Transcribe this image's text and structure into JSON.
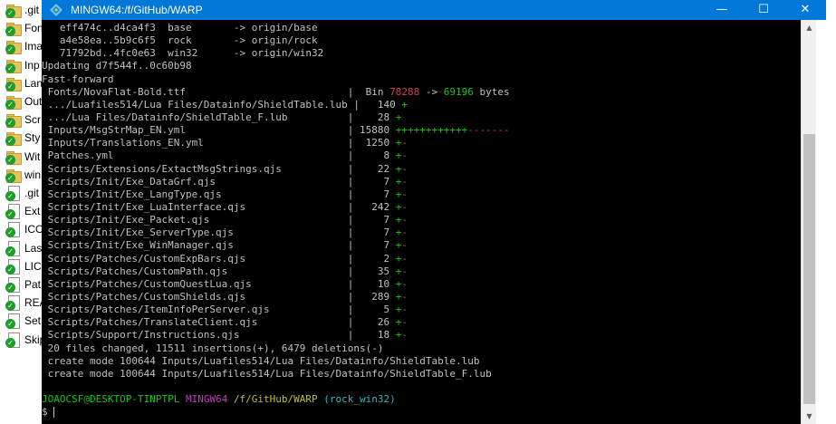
{
  "explorer": {
    "items": [
      {
        "label": ".git",
        "kind": "folder"
      },
      {
        "label": "Fon",
        "kind": "folder"
      },
      {
        "label": "Ima",
        "kind": "folder"
      },
      {
        "label": "Inp",
        "kind": "folder"
      },
      {
        "label": "Lan",
        "kind": "folder"
      },
      {
        "label": "Out",
        "kind": "folder"
      },
      {
        "label": "Scr",
        "kind": "folder"
      },
      {
        "label": "Sty",
        "kind": "folder"
      },
      {
        "label": "Wit",
        "kind": "folder"
      },
      {
        "label": "win",
        "kind": "folder"
      },
      {
        "label": ".git",
        "kind": "file"
      },
      {
        "label": "Ext",
        "kind": "file"
      },
      {
        "label": "ICO",
        "kind": "file"
      },
      {
        "label": "Las",
        "kind": "file"
      },
      {
        "label": "LIC",
        "kind": "file"
      },
      {
        "label": "Pat",
        "kind": "file"
      },
      {
        "label": "REA",
        "kind": "file"
      },
      {
        "label": "Set",
        "kind": "file"
      },
      {
        "label": "Skip",
        "kind": "file"
      }
    ]
  },
  "window": {
    "title": "MINGW64:/f/GitHub/WARP",
    "minimize": "—",
    "maximize": "☐",
    "close": "✕"
  },
  "terminal": {
    "lines": [
      [
        {
          "t": "   eff474c..d4ca4f3  base       -> origin/base",
          "c": "w"
        }
      ],
      [
        {
          "t": "   a4e58ea..5b9c6f5  rock       -> origin/rock",
          "c": "w"
        }
      ],
      [
        {
          "t": "   71792bd..4fc0e63  win32      -> origin/win32",
          "c": "w"
        }
      ],
      [
        {
          "t": "Updating d7f544f..0c60b98",
          "c": "w"
        }
      ],
      [
        {
          "t": "Fast-forward",
          "c": "w"
        }
      ],
      [
        {
          "t": " Fonts/NovaFlat-Bold.ttf                           |  Bin ",
          "c": "w"
        },
        {
          "t": "78288",
          "c": "r"
        },
        {
          "t": " -> ",
          "c": "w"
        },
        {
          "t": "69196",
          "c": "g"
        },
        {
          "t": " bytes",
          "c": "w"
        }
      ],
      [
        {
          "t": " .../Luafiles514/Lua Files/Datainfo/ShieldTable.lub |   140 ",
          "c": "w"
        },
        {
          "t": "+",
          "c": "g"
        }
      ],
      [
        {
          "t": " .../Lua Files/Datainfo/ShieldTable_F.lub          |    28 ",
          "c": "w"
        },
        {
          "t": "+",
          "c": "g"
        }
      ],
      [
        {
          "t": " Inputs/MsgStrMap_EN.yml                           | 15880 ",
          "c": "w"
        },
        {
          "t": "++++++++++++",
          "c": "g"
        },
        {
          "t": "-------",
          "c": "r"
        }
      ],
      [
        {
          "t": " Inputs/Translations_EN.yml                        |  1250 ",
          "c": "w"
        },
        {
          "t": "+",
          "c": "g"
        },
        {
          "t": "-",
          "c": "r"
        }
      ],
      [
        {
          "t": " Patches.yml                                       |     8 ",
          "c": "w"
        },
        {
          "t": "+",
          "c": "g"
        },
        {
          "t": "-",
          "c": "r"
        }
      ],
      [
        {
          "t": " Scripts/Extensions/ExtactMsgStrings.qjs           |    22 ",
          "c": "w"
        },
        {
          "t": "+",
          "c": "g"
        },
        {
          "t": "-",
          "c": "r"
        }
      ],
      [
        {
          "t": " Scripts/Init/Exe_DataGrf.qjs                      |     7 ",
          "c": "w"
        },
        {
          "t": "+",
          "c": "g"
        },
        {
          "t": "-",
          "c": "r"
        }
      ],
      [
        {
          "t": " Scripts/Init/Exe_LangType.qjs                     |     7 ",
          "c": "w"
        },
        {
          "t": "+",
          "c": "g"
        },
        {
          "t": "-",
          "c": "r"
        }
      ],
      [
        {
          "t": " Scripts/Init/Exe_LuaInterface.qjs                 |   242 ",
          "c": "w"
        },
        {
          "t": "+",
          "c": "g"
        },
        {
          "t": "-",
          "c": "r"
        }
      ],
      [
        {
          "t": " Scripts/Init/Exe_Packet.qjs                       |     7 ",
          "c": "w"
        },
        {
          "t": "+",
          "c": "g"
        },
        {
          "t": "-",
          "c": "r"
        }
      ],
      [
        {
          "t": " Scripts/Init/Exe_ServerType.qjs                   |     7 ",
          "c": "w"
        },
        {
          "t": "+",
          "c": "g"
        },
        {
          "t": "-",
          "c": "r"
        }
      ],
      [
        {
          "t": " Scripts/Init/Exe_WinManager.qjs                   |     7 ",
          "c": "w"
        },
        {
          "t": "+",
          "c": "g"
        },
        {
          "t": "-",
          "c": "r"
        }
      ],
      [
        {
          "t": " Scripts/Patches/CustomExpBars.qjs                 |     2 ",
          "c": "w"
        },
        {
          "t": "+",
          "c": "g"
        },
        {
          "t": "-",
          "c": "r"
        }
      ],
      [
        {
          "t": " Scripts/Patches/CustomPath.qjs                    |    35 ",
          "c": "w"
        },
        {
          "t": "+",
          "c": "g"
        },
        {
          "t": "-",
          "c": "r"
        }
      ],
      [
        {
          "t": " Scripts/Patches/CustomQuestLua.qjs                |    10 ",
          "c": "w"
        },
        {
          "t": "+",
          "c": "g"
        },
        {
          "t": "-",
          "c": "r"
        }
      ],
      [
        {
          "t": " Scripts/Patches/CustomShields.qjs                 |   289 ",
          "c": "w"
        },
        {
          "t": "+",
          "c": "g"
        },
        {
          "t": "-",
          "c": "r"
        }
      ],
      [
        {
          "t": " Scripts/Patches/ItemInfoPerServer.qjs             |     5 ",
          "c": "w"
        },
        {
          "t": "+",
          "c": "g"
        },
        {
          "t": "-",
          "c": "r"
        }
      ],
      [
        {
          "t": " Scripts/Patches/TranslateClient.qjs               |    26 ",
          "c": "w"
        },
        {
          "t": "+",
          "c": "g"
        },
        {
          "t": "-",
          "c": "r"
        }
      ],
      [
        {
          "t": " Scripts/Support/Instructions.qjs                  |    18 ",
          "c": "w"
        },
        {
          "t": "+",
          "c": "g"
        },
        {
          "t": "-",
          "c": "r"
        }
      ],
      [
        {
          "t": " 20 files changed, 11511 insertions(+), 6479 deletions(-)",
          "c": "w"
        }
      ],
      [
        {
          "t": " create mode 100644 Inputs/Luafiles514/Lua Files/Datainfo/ShieldTable.lub",
          "c": "w"
        }
      ],
      [
        {
          "t": " create mode 100644 Inputs/Luafiles514/Lua Files/Datainfo/ShieldTable_F.lub",
          "c": "w"
        }
      ],
      [
        {
          "t": "",
          "c": "w"
        }
      ],
      [
        {
          "t": "JOAOCSF@DESKTOP-TINPTPL",
          "c": "g"
        },
        {
          "t": " ",
          "c": "w"
        },
        {
          "t": "MINGW64",
          "c": "m"
        },
        {
          "t": " ",
          "c": "w"
        },
        {
          "t": "/f/GitHub/WARP",
          "c": "y"
        },
        {
          "t": " ",
          "c": "w"
        },
        {
          "t": "(rock_win32)",
          "c": "c"
        }
      ],
      [
        {
          "t": "$ ",
          "c": "w"
        }
      ]
    ]
  },
  "colors": {
    "titlebar": "#0078d7",
    "terminal_bg": "#000000",
    "text": "#c0c0c0",
    "green": "#1ac51a",
    "red": "#d24040",
    "magenta": "#c33bc3",
    "yellow": "#c2c02e",
    "cyan": "#2fb8c4"
  }
}
